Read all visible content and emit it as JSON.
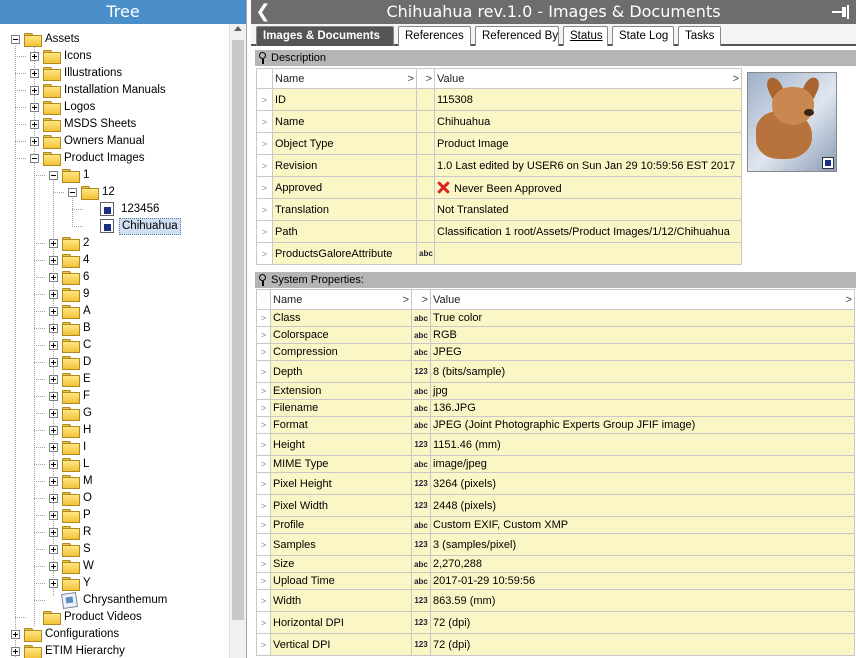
{
  "tree": {
    "title": "Tree",
    "nodes": [
      {
        "label": "Assets"
      },
      {
        "label": "Icons"
      },
      {
        "label": "Illustrations"
      },
      {
        "label": "Installation Manuals"
      },
      {
        "label": "Logos"
      },
      {
        "label": "MSDS Sheets"
      },
      {
        "label": "Owners Manual"
      },
      {
        "label": "Product Images"
      },
      {
        "label": "1"
      },
      {
        "label": "12"
      },
      {
        "label": "123456"
      },
      {
        "label": "Chihuahua"
      },
      {
        "label": "2"
      },
      {
        "label": "4"
      },
      {
        "label": "6"
      },
      {
        "label": "9"
      },
      {
        "label": "A"
      },
      {
        "label": "B"
      },
      {
        "label": "C"
      },
      {
        "label": "D"
      },
      {
        "label": "E"
      },
      {
        "label": "F"
      },
      {
        "label": "G"
      },
      {
        "label": "H"
      },
      {
        "label": "I"
      },
      {
        "label": "L"
      },
      {
        "label": "M"
      },
      {
        "label": "O"
      },
      {
        "label": "P"
      },
      {
        "label": "R"
      },
      {
        "label": "S"
      },
      {
        "label": "W"
      },
      {
        "label": "Y"
      },
      {
        "label": "Chrysanthemum"
      },
      {
        "label": "Product Videos"
      },
      {
        "label": "Configurations"
      },
      {
        "label": "ETIM Hierarchy"
      }
    ],
    "selected": "Chihuahua"
  },
  "header": {
    "title": "Chihuahua rev.1.0 - Images & Documents",
    "back_glyph": "❮"
  },
  "tabs": [
    {
      "label": "Images & Documents"
    },
    {
      "label": "References"
    },
    {
      "label": "Referenced By"
    },
    {
      "label": "Status"
    },
    {
      "label": "State Log"
    },
    {
      "label": "Tasks"
    }
  ],
  "description": {
    "section_label": "Description",
    "col_name": "Name",
    "col_value": "Value",
    "sort_glyph": ">",
    "rows": [
      {
        "name": "ID",
        "value": "115308",
        "type": ""
      },
      {
        "name": "Name",
        "value": "Chihuahua",
        "type": ""
      },
      {
        "name": "Object Type",
        "value": "Product Image",
        "type": ""
      },
      {
        "name": "Revision",
        "value": "1.0 Last edited by USER6 on Sun Jan 29 10:59:56 EST 2017",
        "type": ""
      },
      {
        "name": "Approved",
        "value": "Never Been Approved",
        "type": ""
      },
      {
        "name": "Translation",
        "value": "Not Translated",
        "type": ""
      },
      {
        "name": "Path",
        "value": "Classification 1 root/Assets/Product Images/1/12/Chihuahua",
        "type": ""
      },
      {
        "name": "ProductsGaloreAttribute",
        "value": "",
        "type": "abc"
      }
    ]
  },
  "system": {
    "section_label": "System Properties:",
    "col_name": "Name",
    "col_value": "Value",
    "rows": [
      {
        "name": "Class",
        "type": "abc",
        "value": "True color"
      },
      {
        "name": "Colorspace",
        "type": "abc",
        "value": "RGB"
      },
      {
        "name": "Compression",
        "type": "abc",
        "value": "JPEG"
      },
      {
        "name": "Depth",
        "type": "123",
        "value": "8 (bits/sample)"
      },
      {
        "name": "Extension",
        "type": "abc",
        "value": "jpg"
      },
      {
        "name": "Filename",
        "type": "abc",
        "value": "136.JPG"
      },
      {
        "name": "Format",
        "type": "abc",
        "value": "JPEG (Joint Photographic Experts Group JFIF image)"
      },
      {
        "name": "Height",
        "type": "123",
        "value": "1151.46 (mm)"
      },
      {
        "name": "MIME Type",
        "type": "abc",
        "value": "image/jpeg"
      },
      {
        "name": "Pixel Height",
        "type": "123",
        "value": "3264 (pixels)"
      },
      {
        "name": "Pixel Width",
        "type": "123",
        "value": "2448 (pixels)"
      },
      {
        "name": "Profile",
        "type": "abc",
        "value": "Custom EXIF, Custom XMP"
      },
      {
        "name": "Samples",
        "type": "123",
        "value": "3 (samples/pixel)"
      },
      {
        "name": "Size",
        "type": "abc",
        "value": "2,270,288"
      },
      {
        "name": "Upload Time",
        "type": "abc",
        "value": "2017-01-29 10:59:56"
      },
      {
        "name": "Width",
        "type": "123",
        "value": "863.59 (mm)"
      },
      {
        "name": "Horizontal DPI",
        "type": "123",
        "value": "72 (dpi)"
      },
      {
        "name": "Vertical DPI",
        "type": "123",
        "value": "72 (dpi)"
      }
    ]
  }
}
